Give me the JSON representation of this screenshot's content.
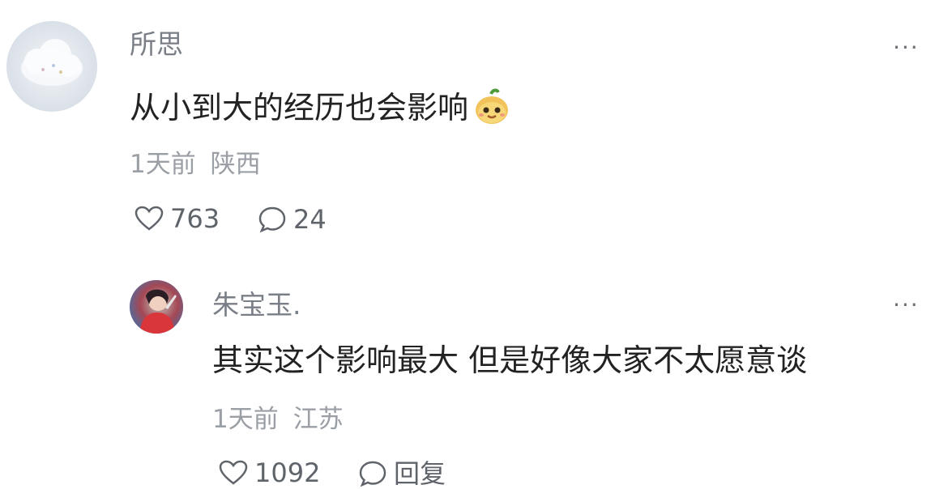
{
  "comment": {
    "author": "所思",
    "text": "从小到大的经历也会影响",
    "emoji": "smiling-fruit-emoji",
    "time": "1天前",
    "location": "陕西",
    "likes": "763",
    "replies": "24",
    "more_label": "···",
    "avatar_icon": "cloud-avatar"
  },
  "reply": {
    "author": "朱宝玉.",
    "text": "其实这个影响最大 但是好像大家不太愿意谈",
    "time": "1天前",
    "location": "江苏",
    "likes": "1092",
    "reply_label": "回复",
    "more_label": "···",
    "avatar_icon": "person-avatar"
  },
  "colors": {
    "name": "#7a7f87",
    "text": "#222222",
    "meta": "#9a9ea5",
    "action": "#5f646b"
  }
}
